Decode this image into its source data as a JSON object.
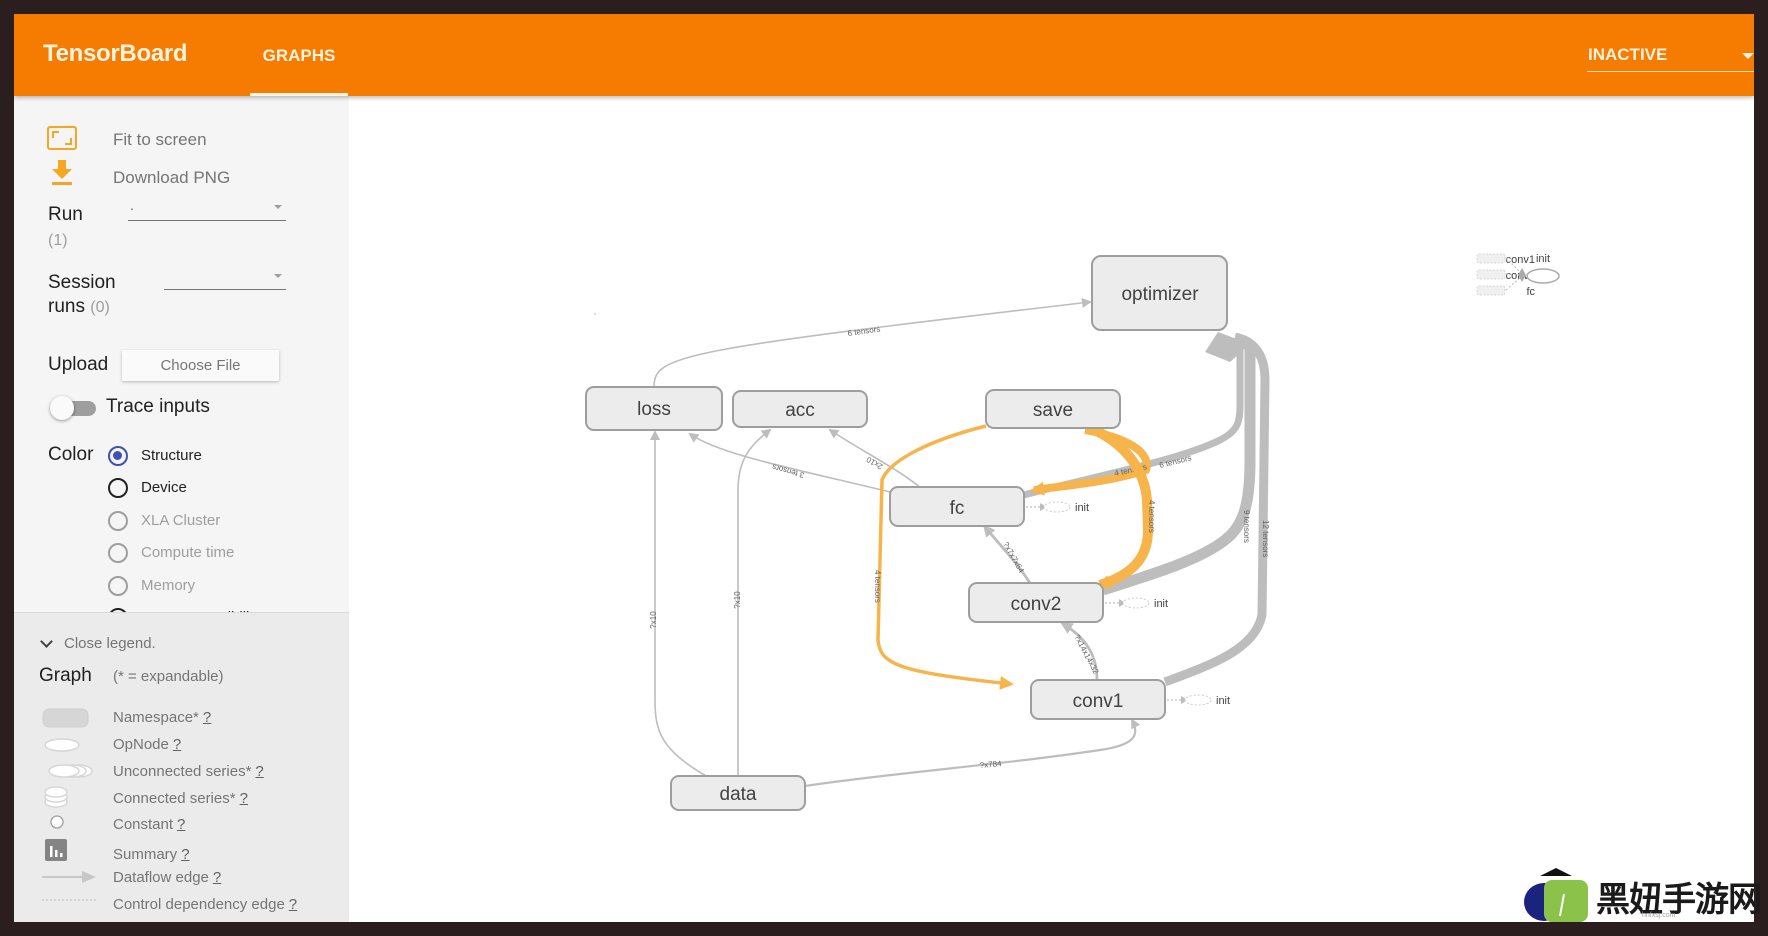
{
  "header": {
    "brand": "TensorBoard",
    "tabs": [
      {
        "label": "GRAPHS",
        "active": true
      }
    ],
    "run_status_select": "INACTIVE",
    "accent_color": "#f57c00"
  },
  "sidebar": {
    "fit_to_screen": "Fit to screen",
    "download_png": "Download PNG",
    "run": {
      "label": "Run",
      "count": "(1)",
      "value": "."
    },
    "session_runs": {
      "label_line1": "Session",
      "label_line2": "runs",
      "count": "(0)",
      "value": ""
    },
    "upload": {
      "label": "Upload",
      "button": "Choose File"
    },
    "trace_inputs": {
      "label": "Trace inputs",
      "enabled": false
    },
    "color": {
      "label": "Color",
      "options": [
        {
          "label": "Structure",
          "checked": true,
          "enabled": true
        },
        {
          "label": "Device",
          "checked": false,
          "enabled": true
        },
        {
          "label": "XLA Cluster",
          "checked": false,
          "enabled": false
        },
        {
          "label": "Compute time",
          "checked": false,
          "enabled": false
        },
        {
          "label": "Memory",
          "checked": false,
          "enabled": false
        },
        {
          "label": "TPU Compatibility",
          "checked": false,
          "enabled": true
        }
      ]
    }
  },
  "legend": {
    "toggle": "Close legend.",
    "title": "Graph",
    "subtitle": "(* = expandable)",
    "help": "?",
    "items": [
      {
        "label": "Namespace*",
        "icon": "namespace-icon"
      },
      {
        "label": "OpNode",
        "icon": "opnode-icon"
      },
      {
        "label": "Unconnected series*",
        "icon": "unconnected-series-icon"
      },
      {
        "label": "Connected series*",
        "icon": "connected-series-icon"
      },
      {
        "label": "Constant",
        "icon": "constant-icon"
      },
      {
        "label": "Summary",
        "icon": "summary-icon"
      },
      {
        "label": "Dataflow edge",
        "icon": "dataflow-edge-icon"
      },
      {
        "label": "Control dependency edge",
        "icon": "control-edge-icon"
      }
    ]
  },
  "graph": {
    "nodes": {
      "optimizer": "optimizer",
      "loss": "loss",
      "acc": "acc",
      "save": "save",
      "fc": "fc",
      "conv2": "conv2",
      "conv1": "conv1",
      "data": "data"
    },
    "init_label": "init",
    "edge_labels": {
      "loss_optimizer": "6 tensors",
      "fc_loss": "3 tensors",
      "fc_acc": "2x10",
      "data_loss": "?x10",
      "data_acc": "?x10",
      "save_fc": "4 tensors",
      "fc_optimizer": "6 tensors",
      "save_conv2": "4 tensors",
      "save_conv1": "4 tensors",
      "conv2_optimizer": "9 tensors",
      "conv1_optimizer": "12 tensors",
      "conv2_fc": "?x7x7x64",
      "conv1_conv2": "?x14x14x32",
      "data_conv1": "?x784"
    },
    "aux_init": {
      "title": "init",
      "inputs": [
        "conv1",
        "conv2",
        "fc"
      ]
    },
    "highlight_color": "#f6b44b",
    "edge_color": "#bdbdbd"
  },
  "watermark": {
    "text": "黑妞手游网",
    "sub": "hnfxsj.com"
  }
}
